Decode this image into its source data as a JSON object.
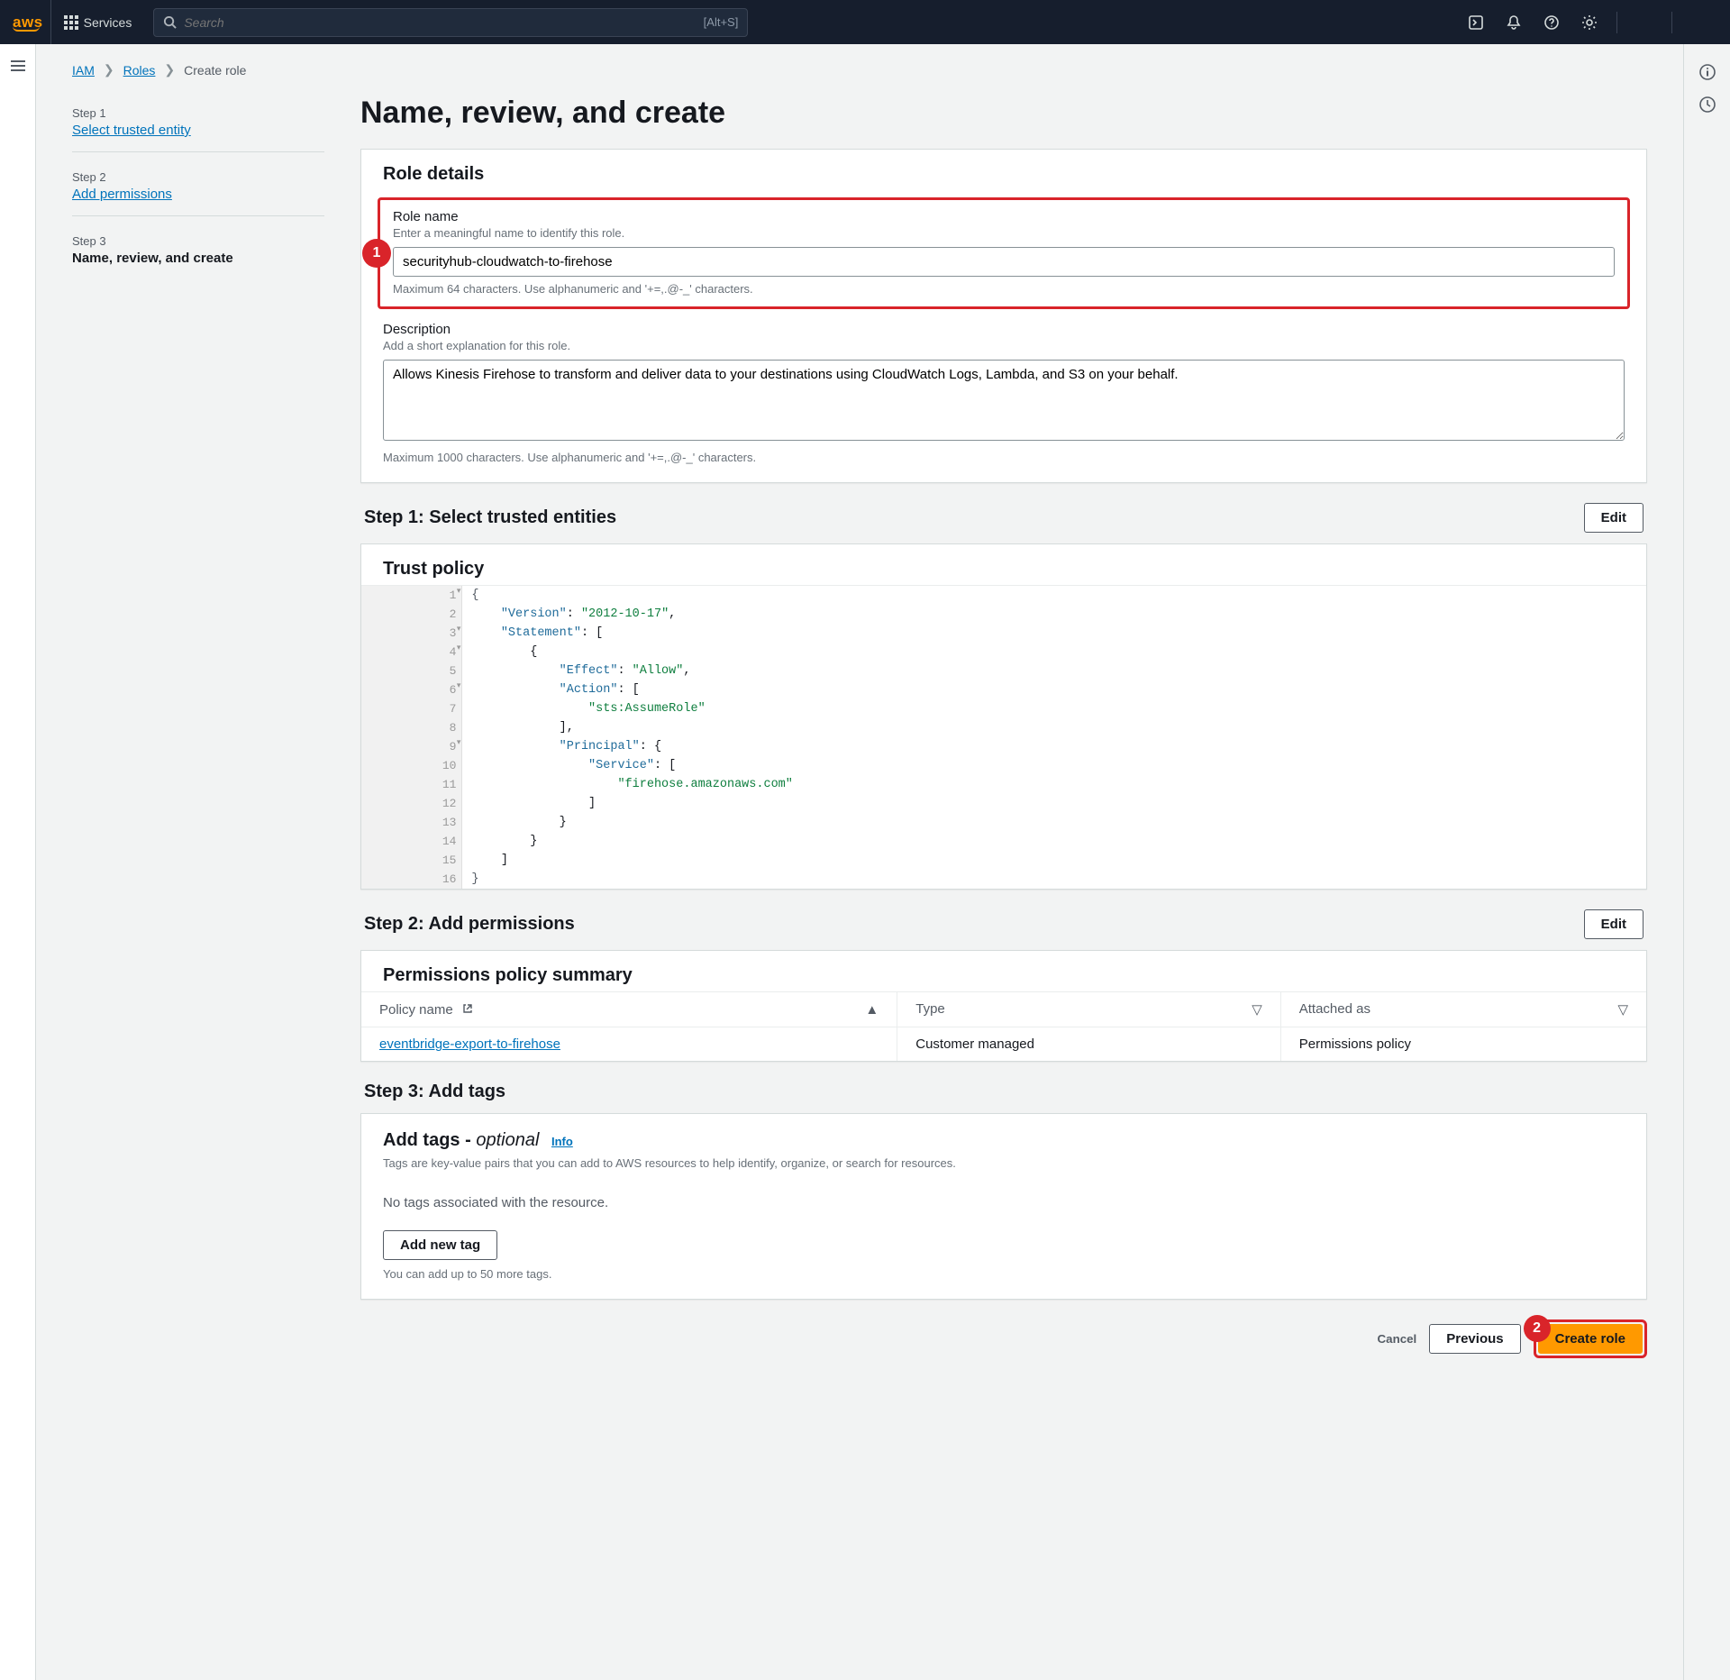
{
  "topnav": {
    "logo": "aws",
    "services_label": "Services",
    "search_placeholder": "Search",
    "search_shortcut": "[Alt+S]"
  },
  "breadcrumbs": {
    "iam": "IAM",
    "roles": "Roles",
    "current": "Create role"
  },
  "wizard": {
    "step1_label": "Step 1",
    "step1_title": "Select trusted entity",
    "step2_label": "Step 2",
    "step2_title": "Add permissions",
    "step3_label": "Step 3",
    "step3_title": "Name, review, and create"
  },
  "page": {
    "heading": "Name, review, and create"
  },
  "role_details": {
    "panel_title": "Role details",
    "name_label": "Role name",
    "name_hint": "Enter a meaningful name to identify this role.",
    "name_value": "securityhub-cloudwatch-to-firehose",
    "name_helper": "Maximum 64 characters. Use alphanumeric and '+=,.@-_' characters.",
    "desc_label": "Description",
    "desc_hint": "Add a short explanation for this role.",
    "desc_value": "Allows Kinesis Firehose to transform and deliver data to your destinations using CloudWatch Logs, Lambda, and S3 on your behalf.",
    "desc_helper": "Maximum 1000 characters. Use alphanumeric and '+=,.@-_' characters."
  },
  "step1": {
    "heading": "Step 1: Select trusted entities",
    "edit": "Edit",
    "trust_title": "Trust policy",
    "code": {
      "l1": "{",
      "l2": "    \"Version\": \"2012-10-17\",",
      "l3": "    \"Statement\": [",
      "l4": "        {",
      "l5": "            \"Effect\": \"Allow\",",
      "l6": "            \"Action\": [",
      "l7": "                \"sts:AssumeRole\"",
      "l8": "            ],",
      "l9": "            \"Principal\": {",
      "l10": "                \"Service\": [",
      "l11": "                    \"firehose.amazonaws.com\"",
      "l12": "                ]",
      "l13": "            }",
      "l14": "        }",
      "l15": "    ]",
      "l16": "}"
    }
  },
  "step2": {
    "heading": "Step 2: Add permissions",
    "edit": "Edit",
    "summary_title": "Permissions policy summary",
    "columns": {
      "policy": "Policy name",
      "type": "Type",
      "attached": "Attached as"
    },
    "row": {
      "policy": "eventbridge-export-to-firehose",
      "type": "Customer managed",
      "attached": "Permissions policy"
    }
  },
  "step3": {
    "heading": "Step 3: Add tags",
    "tags_title": "Add tags - ",
    "tags_optional": "optional",
    "info": "Info",
    "tags_hint": "Tags are key-value pairs that you can add to AWS resources to help identify, organize, or search for resources.",
    "empty": "No tags associated with the resource.",
    "add_btn": "Add new tag",
    "limit": "You can add up to 50 more tags."
  },
  "footer": {
    "cancel": "Cancel",
    "previous": "Previous",
    "create": "Create role"
  },
  "callouts": {
    "one": "1",
    "two": "2"
  }
}
